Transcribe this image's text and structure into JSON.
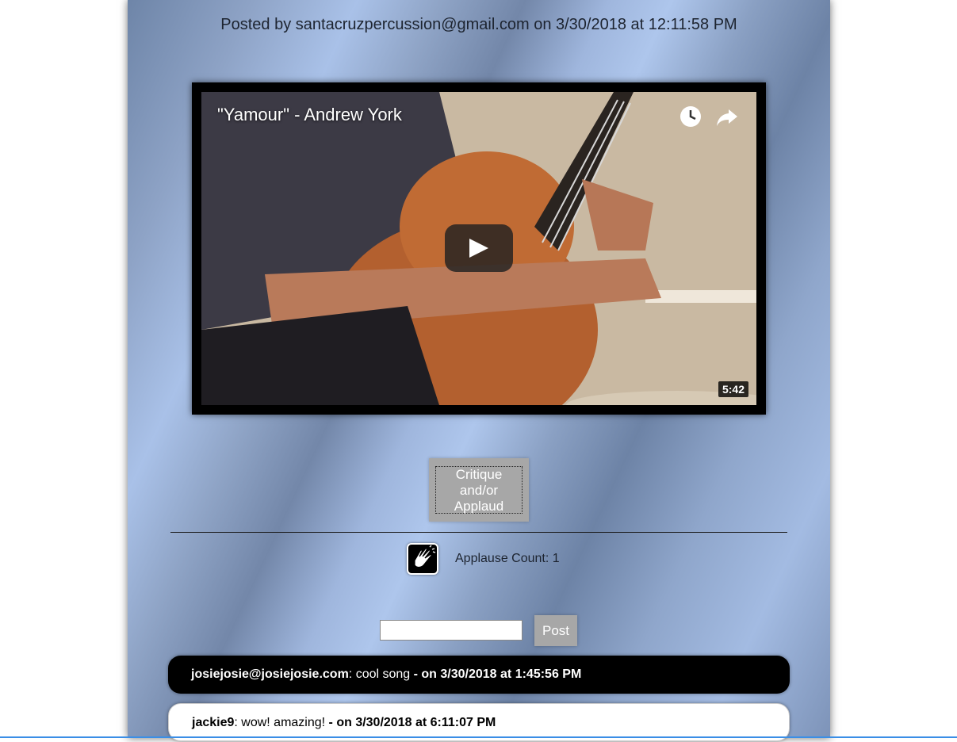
{
  "post": {
    "posted_by": "Posted by santacruzpercussion@gmail.com on 3/30/2018 at 12:11:58 PM"
  },
  "video": {
    "title": "\"Yamour\" - Andrew York",
    "duration": "5:42",
    "icons": [
      "clock-icon",
      "share-icon",
      "play-icon"
    ]
  },
  "critique": {
    "label": "Critique and/or Applaud"
  },
  "applause": {
    "label": "Applause Count: 1"
  },
  "comment_form": {
    "input_value": "",
    "post_label": "Post"
  },
  "comments": [
    {
      "author": "josiejosie@josiejosie.com",
      "text": ": cool song ",
      "when": "- on 3/30/2018 at 1:45:56 PM"
    },
    {
      "author": "jackie9",
      "text": ": wow! amazing! ",
      "when": "- on 3/30/2018 at 6:11:07 PM"
    }
  ],
  "colors": {
    "button_gray": "#a7a7a7",
    "comment_dark": "#000000",
    "comment_light": "#ffffff",
    "panel_blue": "#8ea3c6"
  }
}
